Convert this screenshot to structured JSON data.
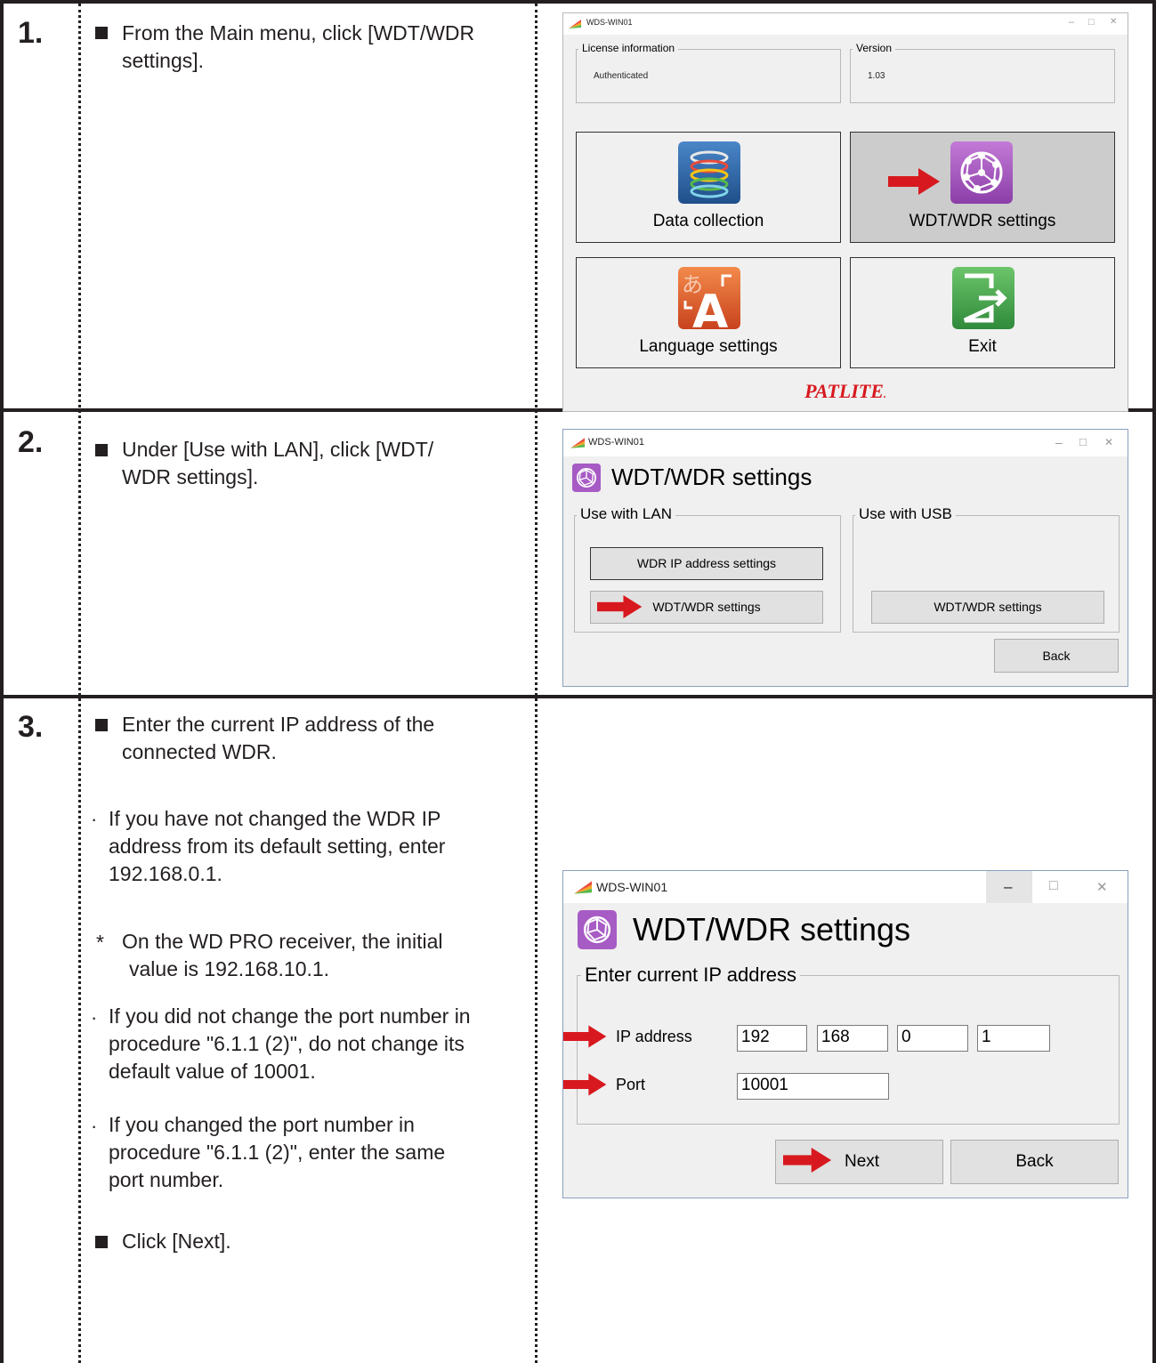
{
  "steps": [
    {
      "number": "1.",
      "items": [
        {
          "type": "square",
          "text_lines": [
            "From the Main menu, click [WDT/WDR",
            "settings]."
          ]
        }
      ]
    },
    {
      "number": "2.",
      "items": [
        {
          "type": "square",
          "text_lines": [
            "Under [Use with LAN], click [WDT/",
            "WDR settings]."
          ]
        }
      ]
    },
    {
      "number": "3.",
      "items": [
        {
          "type": "square",
          "text_lines": [
            "Enter the current IP address of the",
            "connected WDR."
          ]
        },
        {
          "type": "dot",
          "text_lines": [
            "If you have not changed the WDR IP",
            "address from its default setting, enter",
            "192.168.0.1."
          ]
        },
        {
          "type": "note",
          "marker": "*",
          "text_lines": [
            "On the WD PRO receiver, the initial",
            "value is 192.168.10.1."
          ]
        },
        {
          "type": "dot",
          "text_lines": [
            "If you did not change the port number in",
            "procedure \"6.1.1 (2)\", do not change its",
            "default value of 10001."
          ]
        },
        {
          "type": "dot",
          "text_lines": [
            "If you changed the port number in",
            "procedure \"6.1.1 (2)\", enter the same",
            "port number."
          ]
        },
        {
          "type": "square",
          "text_lines": [
            "Click [Next]."
          ]
        }
      ]
    }
  ],
  "screen1": {
    "window_title": "WDS-WIN01",
    "controls": {
      "minimize": "–",
      "maximize": "□",
      "close": "✕"
    },
    "license_group": {
      "legend": "License information",
      "value": "Authenticated"
    },
    "version_group": {
      "legend": "Version",
      "value": "1.03"
    },
    "buttons": {
      "data_collection": "Data collection",
      "wdt_wdr": "WDT/WDR settings",
      "language": "Language settings",
      "exit": "Exit"
    },
    "brand": "PATLITE",
    "brand_mark": ".",
    "selected_button": "wdt_wdr",
    "icons": [
      "database-icon",
      "network-icon",
      "language-icon",
      "exit-icon"
    ]
  },
  "screen2": {
    "window_title": "WDS-WIN01",
    "controls": {
      "minimize": "–",
      "maximize": "□",
      "close": "✕"
    },
    "heading": "WDT/WDR settings",
    "lan_group": {
      "legend": "Use with LAN",
      "ip_button": "WDR IP address settings",
      "settings_button": "WDT/WDR settings"
    },
    "usb_group": {
      "legend": "Use with USB",
      "settings_button": "WDT/WDR settings"
    },
    "back_button": "Back"
  },
  "screen3": {
    "window_title": "WDS-WIN01",
    "controls": {
      "minimize": "–",
      "maximize": "□",
      "close": "✕"
    },
    "heading": "WDT/WDR settings",
    "group_legend": "Enter current IP address",
    "ip_label": "IP address",
    "ip_octets": [
      "192",
      "168",
      "0",
      "1"
    ],
    "port_label": "Port",
    "port_value": "10001",
    "next_button": "Next",
    "back_button": "Back"
  },
  "colors": {
    "ink": "#231f20",
    "arrow_red": "#d7191f",
    "brand_red": "#d7191f",
    "window_bg": "#f0f0f0",
    "selected_tile": "#cccccc"
  }
}
